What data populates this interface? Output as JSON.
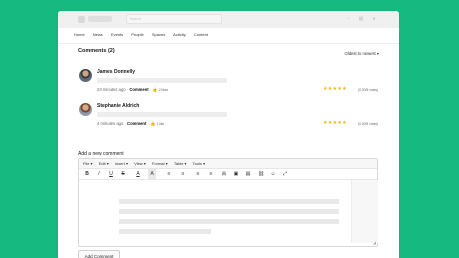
{
  "topbar": {
    "search_placeholder": "Search"
  },
  "nav": {
    "items": [
      "Home",
      "News",
      "Events",
      "People",
      "Spaces",
      "Activity",
      "Content"
    ]
  },
  "comments": {
    "title": "Comments (2)",
    "sort": "Oldest to newest ▾",
    "items": [
      {
        "name": "James Donnelly",
        "time": "23 minutes ago",
        "comment_label": "Comment",
        "likes": "2 likes",
        "stars": "★★★★★",
        "rating": "(0.00/5 votes)"
      },
      {
        "name": "Stephanie Aldrich",
        "time": "4 minutes ago",
        "comment_label": "Comment",
        "likes": "1 like",
        "stars": "★★★★★",
        "rating": "(0.00/5 votes)"
      }
    ]
  },
  "editor": {
    "heading": "Add a new comment",
    "menus": [
      "File ▾",
      "Edit ▾",
      "Insert ▾",
      "View ▾",
      "Format ▾",
      "Table ▾",
      "Tools ▾"
    ],
    "toolbar": [
      "B",
      "I",
      "U",
      "S",
      "A",
      "A",
      "≡",
      "≡",
      "≡",
      "≡",
      "⊞",
      "▣",
      "▤",
      "⛓",
      "☺",
      "⤢"
    ],
    "submit": "Add Comment"
  }
}
